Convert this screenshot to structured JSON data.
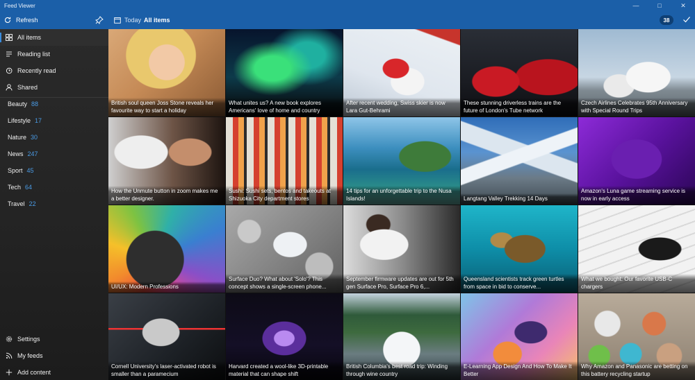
{
  "window": {
    "title": "Feed Viewer"
  },
  "commandbar": {
    "refresh_label": "Refresh",
    "today_label": "Today",
    "current_view": "All items",
    "unread_count": "38"
  },
  "sidebar": {
    "nav": [
      {
        "label": "All items",
        "icon": "grid-icon"
      },
      {
        "label": "Reading list",
        "icon": "reading-list-icon"
      },
      {
        "label": "Recently read",
        "icon": "history-icon"
      },
      {
        "label": "Shared",
        "icon": "person-icon"
      }
    ],
    "categories": [
      {
        "label": "Beauty",
        "count": "88"
      },
      {
        "label": "Lifestyle",
        "count": "17"
      },
      {
        "label": "Nature",
        "count": "30"
      },
      {
        "label": "News",
        "count": "247"
      },
      {
        "label": "Sport",
        "count": "45"
      },
      {
        "label": "Tech",
        "count": "64"
      },
      {
        "label": "Travel",
        "count": "22"
      }
    ],
    "footer": [
      {
        "label": "Settings",
        "icon": "gear-icon"
      },
      {
        "label": "My feeds",
        "icon": "feeds-icon"
      },
      {
        "label": "Add content",
        "icon": "plus-icon"
      }
    ]
  },
  "articles": [
    {
      "title": "British soul queen Joss Stone reveals her favourite way to start a holiday",
      "image": "portrait-blonde-woman"
    },
    {
      "title": "What unites us? A new book explores Americans' love of home and country",
      "image": "aurora-night-sky"
    },
    {
      "title": "After recent wedding, Swiss skier is now Lara Gut-Behrami",
      "image": "slalom-skier"
    },
    {
      "title": "These stunning driverless trains are the future of London's Tube network",
      "image": "red-tube-trains"
    },
    {
      "title": "Czech Airlines Celebrates 95th Anniversary with Special Round Trips",
      "image": "airliners-on-tarmac"
    },
    {
      "title": "How the Unmute button in zoom makes me a better designer.",
      "image": "woman-with-statue"
    },
    {
      "title": "Sushi: Sushi sets, bentos and takeouts at Shizuoka City department stores",
      "image": "sushi-trays"
    },
    {
      "title": "14 tips for an unforgettable trip to the Nusa Islands!",
      "image": "coastal-cliffs"
    },
    {
      "title": "Langtang Valley Trekking 14 Days",
      "image": "snowy-mountains"
    },
    {
      "title": "Amazon's Luna game streaming service is now in early access",
      "image": "purple-game-controller"
    },
    {
      "title": "UI/UX: Modern Professions",
      "image": "colour-wheel-chart"
    },
    {
      "title": "Surface Duo? What about 'Solo'? This concept shows a single-screen phone...",
      "image": "phone-on-pebbles"
    },
    {
      "title": "September firmware updates are out for 5th gen Surface Pro, Surface Pro 6,...",
      "image": "woman-using-tablet-in-car"
    },
    {
      "title": "Queensland scientists track green turtles from space in bid to conserve...",
      "image": "sea-turtle"
    },
    {
      "title": "What we bought: Our favorite USB-C chargers",
      "image": "usb-c-cable-keyboard"
    },
    {
      "title": "Cornell University's laser-activated robot is smaller than a paramecium",
      "image": "laser-microchip"
    },
    {
      "title": "Harvard created a wool-like 3D-printable material that can shape shift",
      "image": "glowing-petri-dish"
    },
    {
      "title": "British Columbia's best road trip: Winding through wine country",
      "image": "forest-waterfall"
    },
    {
      "title": "E-Learning App Design And How To Make It Better",
      "image": "illustrated-woman-laptop"
    },
    {
      "title": "Why Amazon and Panasonic are betting on this battery recycling startup",
      "image": "powder-dishes"
    }
  ]
}
